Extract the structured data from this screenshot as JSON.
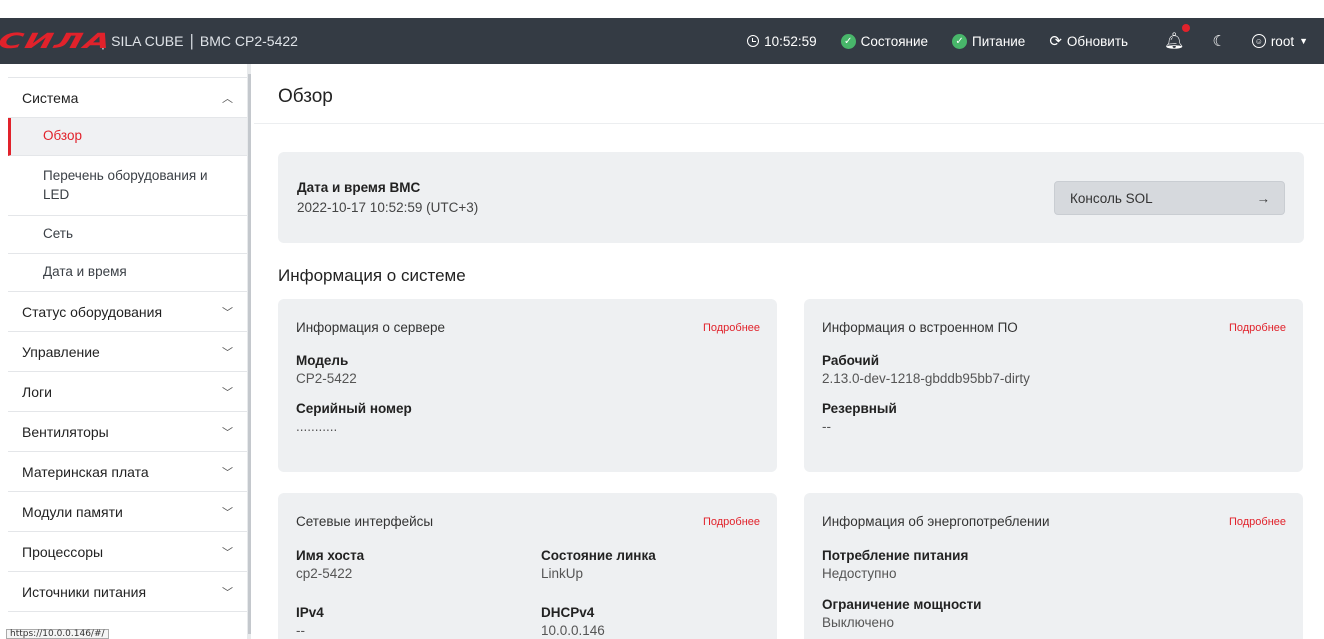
{
  "header": {
    "logo_text": "СИЛА",
    "brand": "SILA CUBE",
    "bmc": "BMC CP2-5422",
    "time": "10:52:59",
    "status_label": "Состояние",
    "power_label": "Питание",
    "refresh_label": "Обновить",
    "user": "root"
  },
  "sidebar": {
    "system": "Система",
    "overview": "Обзор",
    "inventory": "Перечень оборудования и LED",
    "network": "Сеть",
    "datetime": "Дата и время",
    "hardware_status": "Статус оборудования",
    "control": "Управление",
    "logs": "Логи",
    "fans": "Вентиляторы",
    "motherboard": "Материнская плата",
    "memory": "Модули памяти",
    "processors": "Процессоры",
    "power_supplies": "Источники питания"
  },
  "status_bar_url": "https://10.0.0.146/#/",
  "main": {
    "title": "Обзор",
    "bmc_datetime_label": "Дата и время BMC",
    "bmc_datetime_value": "2022-10-17 10:52:59 (UTC+3)",
    "sol_button": "Консоль SOL",
    "sol_arrow": "→",
    "system_info_title": "Информация о системе",
    "more": "Подробнее",
    "server_card": {
      "title": "Информация о сервере",
      "model_label": "Модель",
      "model_value": "CP2-5422",
      "serial_label": "Серийный номер",
      "serial_value": "..........."
    },
    "firmware_card": {
      "title": "Информация о встроенном ПО",
      "running_label": "Рабочий",
      "running_value": "2.13.0-dev-1218-gbddb95bb7-dirty",
      "backup_label": "Резервный",
      "backup_value": "--"
    },
    "network_card": {
      "title": "Сетевые интерфейсы",
      "hostname_label": "Имя хоста",
      "hostname_value": "cp2-5422",
      "link_label": "Состояние линка",
      "link_value": "LinkUp",
      "ipv4_label": "IPv4",
      "ipv4_value": "--",
      "dhcp_label": "DHCPv4",
      "dhcp_value": "10.0.0.146"
    },
    "power_card": {
      "title": "Информация об энергопотреблении",
      "consumption_label": "Потребление питания",
      "consumption_value": "Недоступно",
      "cap_label": "Ограничение мощности",
      "cap_value": "Выключено"
    }
  },
  "colors": {
    "topbar": "#343b44",
    "accent": "#e1222b",
    "ok": "#48b66a",
    "card": "#eef0f2"
  }
}
